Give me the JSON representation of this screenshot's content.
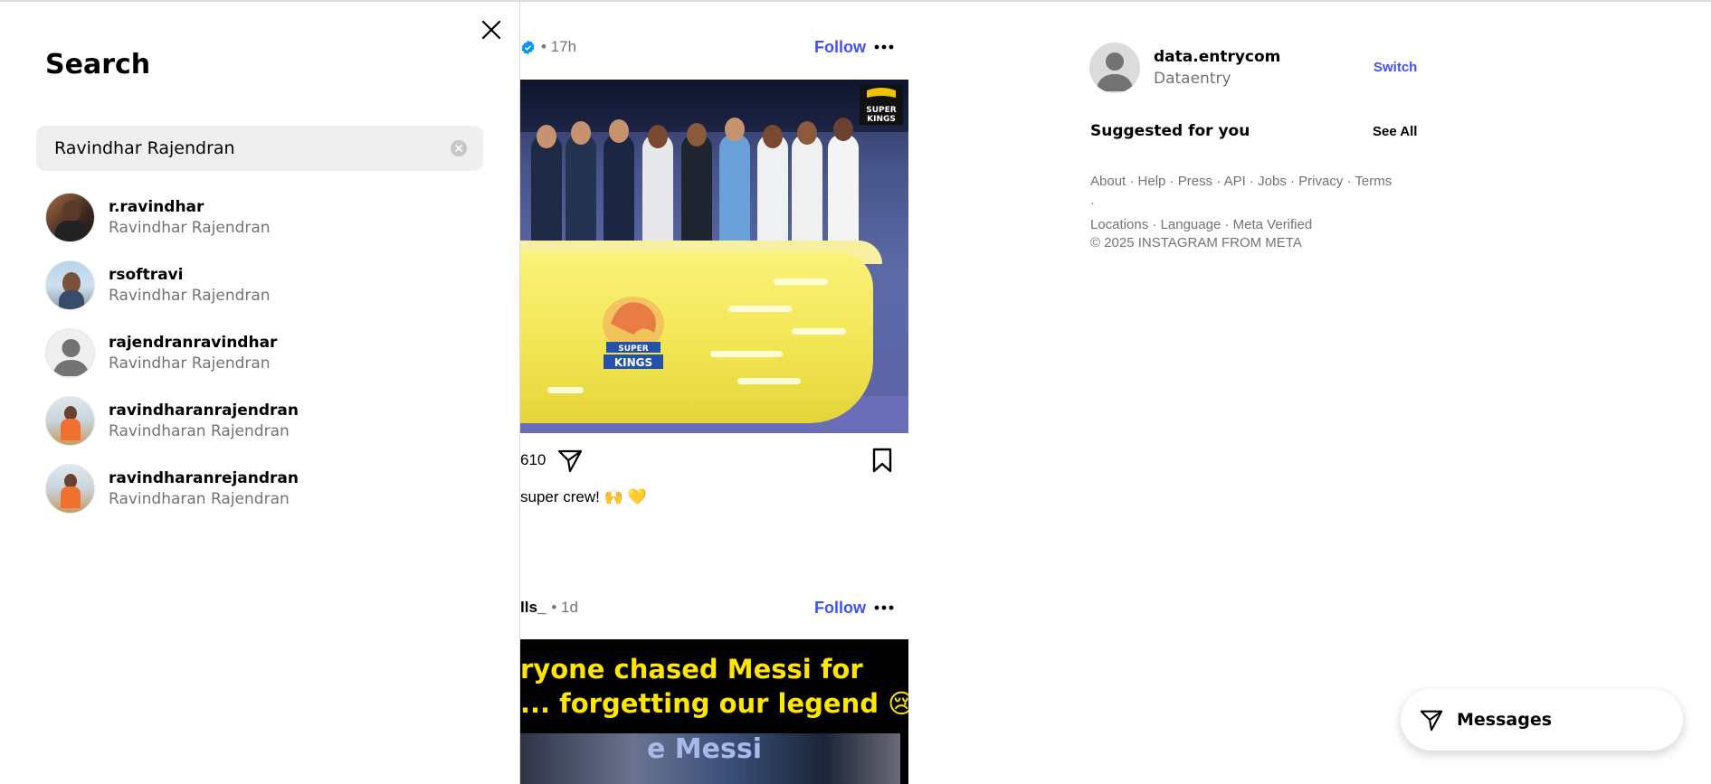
{
  "feed": {
    "posts": [
      {
        "meta": "• 17h",
        "follow_label": "Follow",
        "like_count": "610",
        "caption": "super crew! 🙌 💛",
        "badge_text": "SUPER KINGS"
      },
      {
        "username_tail": "lls_",
        "meta": "• 1d",
        "follow_label": "Follow",
        "image_text_line1": "ryone chased Messi for",
        "image_text_line2": "... forgetting our legend 😢",
        "image_text_line3": "e Messi"
      }
    ]
  },
  "search": {
    "title": "Search",
    "input_value": "Ravindhar Rajendran",
    "results": [
      {
        "username": "r.ravindhar",
        "full_name": "Ravindhar Rajendran"
      },
      {
        "username": "rsoftravi",
        "full_name": "Ravindhar Rajendran"
      },
      {
        "username": "rajendranravindhar",
        "full_name": "Ravindhar Rajendran"
      },
      {
        "username": "ravindharanrajendran",
        "full_name": "Ravindharan Rajendran"
      },
      {
        "username": "ravindharanrejandran",
        "full_name": "Ravindharan Rajendran"
      }
    ]
  },
  "sidebar": {
    "username": "data.entrycom",
    "name": "Dataentry",
    "switch_label": "Switch",
    "suggested_label": "Suggested for you",
    "see_all_label": "See All",
    "footer_links": [
      "About",
      "Help",
      "Press",
      "API",
      "Jobs",
      "Privacy",
      "Terms",
      "Locations",
      "Language",
      "Meta Verified"
    ],
    "copyright": "© 2025 INSTAGRAM FROM META"
  },
  "messages": {
    "label": "Messages"
  },
  "colors": {
    "accent": "#4150f7",
    "muted": "#737373",
    "verified": "#0095f6",
    "yellow": "#ffe500"
  }
}
